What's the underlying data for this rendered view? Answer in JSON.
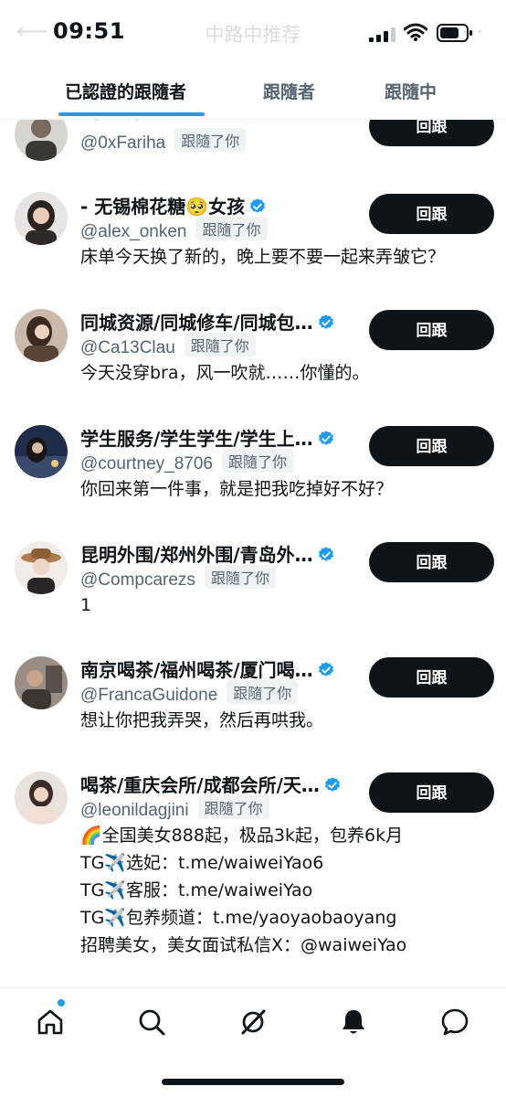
{
  "status_bar": {
    "time": "09:51",
    "ghost_title": "中路中推荐"
  },
  "tabs": [
    {
      "label": "已認證的跟隨者",
      "active": true
    },
    {
      "label": "跟隨者",
      "active": false
    },
    {
      "label": "跟隨中",
      "active": false
    }
  ],
  "follow_badge": "跟隨了你",
  "button_label": "回跟",
  "rows": [
    {
      "name": "Fariha",
      "handle": "@0xFariha",
      "bio": []
    },
    {
      "name": "- 无锡棉花糖🥺女孩",
      "handle": "@alex_onken",
      "bio": [
        "床单今天换了新的，晚上要不要一起来弄皱它？"
      ]
    },
    {
      "name": "同城资源/同城修车/同城包…",
      "handle": "@Ca13Clau",
      "bio": [
        "今天没穿bra，风一吹就……你懂的。"
      ]
    },
    {
      "name": "学生服务/学生学生/学生上…",
      "handle": "@courtney_8706",
      "bio": [
        "你回来第一件事，就是把我吃掉好不好？"
      ]
    },
    {
      "name": "昆明外围/郑州外围/青岛外…",
      "handle": "@Compcarezs",
      "bio": [
        "1"
      ]
    },
    {
      "name": "南京喝茶/福州喝茶/厦门喝…",
      "handle": "@FrancaGuidone",
      "bio": [
        "想让你把我弄哭，然后再哄我。"
      ]
    },
    {
      "name": "喝茶/重庆会所/成都会所/天…",
      "handle": "@leonildagjini",
      "bio": [
        "🌈全国美女888起，极品3k起，包养6k月",
        " TG✈️选妃：t.me/waiweiYao6",
        "TG✈️客服：t.me/waiweiYao",
        "TG✈️包养频道：t.me/yaoyaobaoyang",
        "招聘美女，美女面试私信X：@waiweiYao"
      ]
    }
  ],
  "colors": {
    "accent": "#1d9bf0",
    "button_bg": "#0f1419",
    "secondary_text": "#536471",
    "badge_bg": "#eff3f4"
  },
  "icons": [
    "home-icon",
    "search-icon",
    "grok-icon",
    "bell-icon",
    "messages-icon"
  ]
}
